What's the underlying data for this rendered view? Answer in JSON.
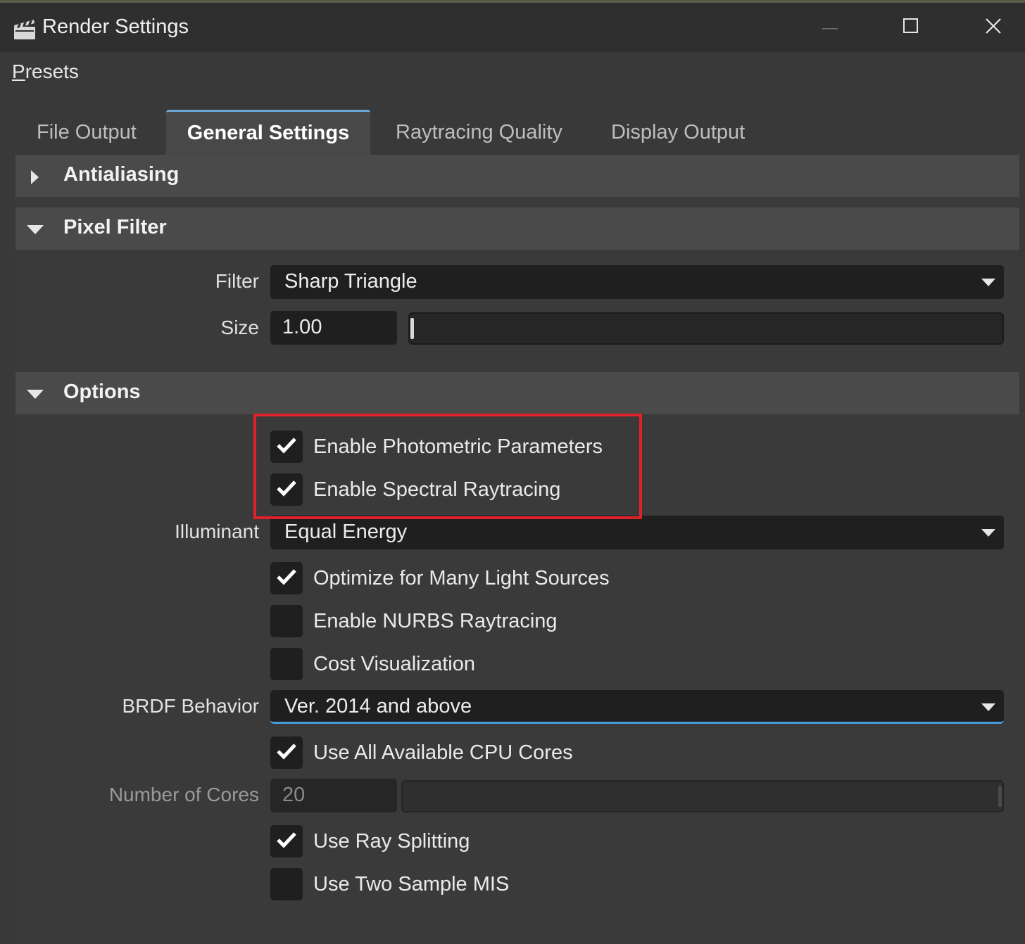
{
  "window": {
    "title": "Render Settings",
    "minimize_icon": "minimize-icon",
    "maximize_icon": "maximize-icon",
    "close_icon": "close-icon",
    "app_icon": "clapperboard-icon"
  },
  "menu": {
    "presets_first": "P",
    "presets_rest": "resets"
  },
  "tabs": [
    {
      "label": "File Output",
      "active": false
    },
    {
      "label": "General Settings",
      "active": true
    },
    {
      "label": "Raytracing Quality",
      "active": false
    },
    {
      "label": "Display Output",
      "active": false
    }
  ],
  "sections": {
    "antialiasing": {
      "label": "Antialiasing",
      "expanded": false
    },
    "pixel_filter": {
      "label": "Pixel Filter",
      "expanded": true
    },
    "options": {
      "label": "Options",
      "expanded": true
    }
  },
  "pixel_filter": {
    "filter_label": "Filter",
    "filter_value": "Sharp Triangle",
    "size_label": "Size",
    "size_value": "1.00"
  },
  "options": {
    "photometric": {
      "label": "Enable Photometric Parameters",
      "checked": true
    },
    "spectral": {
      "label": "Enable Spectral Raytracing",
      "checked": true
    },
    "illuminant_label": "Illuminant",
    "illuminant_value": "Equal Energy",
    "many_lights": {
      "label": "Optimize for Many Light Sources",
      "checked": true
    },
    "nurbs": {
      "label": "Enable NURBS Raytracing",
      "checked": false
    },
    "cost_vis": {
      "label": "Cost Visualization",
      "checked": false
    },
    "brdf_label": "BRDF Behavior",
    "brdf_value": "Ver. 2014 and above",
    "all_cores": {
      "label": "Use All Available CPU Cores",
      "checked": true
    },
    "cores_label": "Number of Cores",
    "cores_value": "20",
    "ray_splitting": {
      "label": "Use Ray Splitting",
      "checked": true
    },
    "two_sample_mis": {
      "label": "Use Two Sample MIS",
      "checked": false
    }
  },
  "colors": {
    "accent": "#4a9bd6",
    "highlight_box": "#e0202a",
    "background": "#393939"
  }
}
